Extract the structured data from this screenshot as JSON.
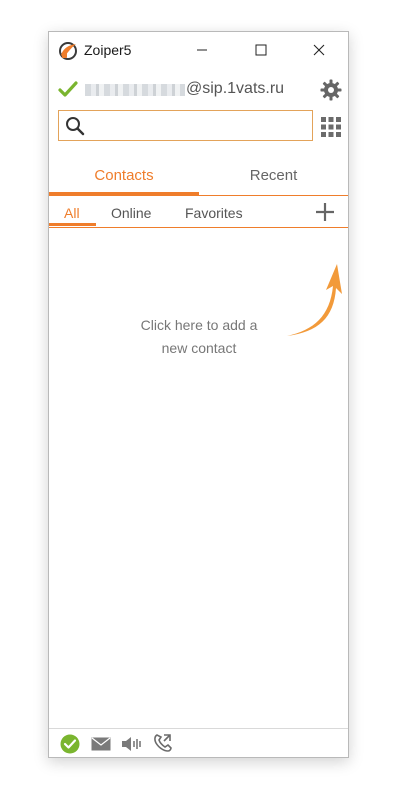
{
  "window": {
    "title": "Zoiper5"
  },
  "account": {
    "domain": "@sip.1vats.ru",
    "status_color": "#7ab52f"
  },
  "search": {
    "placeholder": "",
    "value": ""
  },
  "tabs": {
    "main": [
      {
        "label": "Contacts",
        "active": true
      },
      {
        "label": "Recent",
        "active": false
      }
    ],
    "sub": [
      {
        "label": "All",
        "active": true
      },
      {
        "label": "Online",
        "active": false
      },
      {
        "label": "Favorites",
        "active": false
      }
    ]
  },
  "content": {
    "hint_line1": "Click here to add a",
    "hint_line2": "new contact"
  },
  "colors": {
    "accent": "#ef7d2b",
    "status_ok": "#7ab52f"
  },
  "icons": {
    "titlebar": [
      "zoiper-logo-icon",
      "minimize-icon",
      "maximize-icon",
      "close-icon"
    ],
    "account": [
      "check-icon",
      "gear-icon"
    ],
    "toolbar": [
      "search-icon",
      "dialpad-icon",
      "plus-icon"
    ],
    "bottom": [
      "status-online-icon",
      "mail-icon",
      "speaker-icon",
      "call-forward-icon"
    ]
  }
}
